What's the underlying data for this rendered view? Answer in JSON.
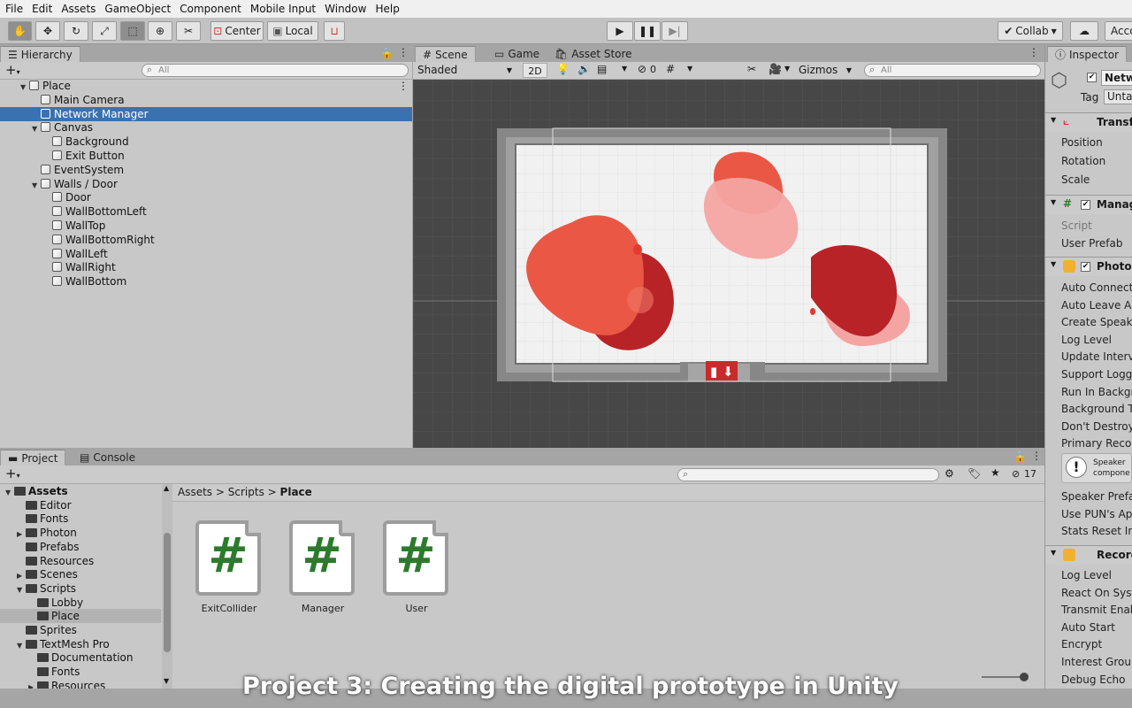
{
  "menu": [
    "File",
    "Edit",
    "Assets",
    "GameObject",
    "Component",
    "Mobile Input",
    "Window",
    "Help"
  ],
  "toolbar": {
    "pivot_label": "Center",
    "space_label": "Local",
    "collab_label": "Collab",
    "account_label": "Acco"
  },
  "hierarchy": {
    "tab": "Hierarchy",
    "search_placeholder": "All",
    "items": [
      {
        "label": "Place",
        "depth": 0,
        "expanded": true,
        "selected": false
      },
      {
        "label": "Main Camera",
        "depth": 1,
        "selected": false
      },
      {
        "label": "Network Manager",
        "depth": 1,
        "selected": true
      },
      {
        "label": "Canvas",
        "depth": 1,
        "expanded": true,
        "selected": false
      },
      {
        "label": "Background",
        "depth": 2,
        "selected": false
      },
      {
        "label": "Exit Button",
        "depth": 2,
        "selected": false
      },
      {
        "label": "EventSystem",
        "depth": 1,
        "selected": false
      },
      {
        "label": "Walls / Door",
        "depth": 1,
        "expanded": true,
        "selected": false
      },
      {
        "label": "Door",
        "depth": 2,
        "selected": false
      },
      {
        "label": "WallBottomLeft",
        "depth": 2,
        "selected": false
      },
      {
        "label": "WallTop",
        "depth": 2,
        "selected": false
      },
      {
        "label": "WallBottomRight",
        "depth": 2,
        "selected": false
      },
      {
        "label": "WallLeft",
        "depth": 2,
        "selected": false
      },
      {
        "label": "WallRight",
        "depth": 2,
        "selected": false
      },
      {
        "label": "WallBottom",
        "depth": 2,
        "selected": false
      }
    ]
  },
  "scene": {
    "tabs": [
      "Scene",
      "Game",
      "Asset Store"
    ],
    "shading_mode": "Shaded",
    "mode_2d": "2D",
    "hidden_count": "0",
    "gizmos_label": "Gizmos",
    "search_placeholder": "All"
  },
  "project": {
    "tabs": [
      "Project",
      "Console"
    ],
    "hidden_count": "17",
    "tree": [
      {
        "label": "Assets",
        "depth": 0,
        "bold": true,
        "expanded": true,
        "selected": false
      },
      {
        "label": "Editor",
        "depth": 1,
        "selected": false
      },
      {
        "label": "Fonts",
        "depth": 1,
        "selected": false
      },
      {
        "label": "Photon",
        "depth": 1,
        "collapsed": true,
        "selected": false
      },
      {
        "label": "Prefabs",
        "depth": 1,
        "selected": false
      },
      {
        "label": "Resources",
        "depth": 1,
        "selected": false
      },
      {
        "label": "Scenes",
        "depth": 1,
        "collapsed": true,
        "selected": false
      },
      {
        "label": "Scripts",
        "depth": 1,
        "expanded": true,
        "selected": false
      },
      {
        "label": "Lobby",
        "depth": 2,
        "selected": false
      },
      {
        "label": "Place",
        "depth": 2,
        "selected": true
      },
      {
        "label": "Sprites",
        "depth": 1,
        "selected": false
      },
      {
        "label": "TextMesh Pro",
        "depth": 1,
        "expanded": true,
        "selected": false
      },
      {
        "label": "Documentation",
        "depth": 2,
        "selected": false
      },
      {
        "label": "Fonts",
        "depth": 2,
        "selected": false
      },
      {
        "label": "Resources",
        "depth": 2,
        "collapsed": true,
        "selected": false
      }
    ],
    "breadcrumb": [
      "Assets",
      "Scripts",
      "Place"
    ],
    "assets": [
      {
        "label": "ExitCollider",
        "icon": "csharp-script-icon"
      },
      {
        "label": "Manager",
        "icon": "csharp-script-icon"
      },
      {
        "label": "User",
        "icon": "csharp-script-icon"
      }
    ]
  },
  "inspector": {
    "tab": "Inspector",
    "object_name": "Netw",
    "tag_label": "Tag",
    "tag_value": "Unta",
    "transform": {
      "title": "Transf",
      "rows": [
        "Position",
        "Rotation",
        "Scale"
      ]
    },
    "manager": {
      "title": "Manag",
      "rows": [
        "Script",
        "User Prefab"
      ]
    },
    "photon": {
      "title": "Photon",
      "rows": [
        "Auto Connect",
        "Auto Leave Ar",
        "Create Speake",
        "Log Level",
        "Update Interva",
        "Support Logge",
        "Run In Backgr",
        "Background T",
        "Don't Destroy",
        "Primary Recor"
      ],
      "help_line1": "Speaker",
      "help_line2": "compone",
      "rows2": [
        "Speaker Prefa",
        "Use PUN's App",
        "Stats Reset In"
      ]
    },
    "recorder": {
      "title": "Record",
      "rows": [
        "Log Level",
        "React On Syst",
        "Transmit Enab",
        "Auto Start",
        "Encrypt",
        "Interest Group",
        "Debug Echo"
      ]
    }
  },
  "caption": "Project 3: Creating the digital prototype in Unity",
  "colors": {
    "selection": "#3a72b0",
    "blob_orange": "#ea5745",
    "blob_dark_red": "#b72327",
    "blob_pink": "#f4a5a3",
    "script_hash": "#2d7a2d"
  }
}
